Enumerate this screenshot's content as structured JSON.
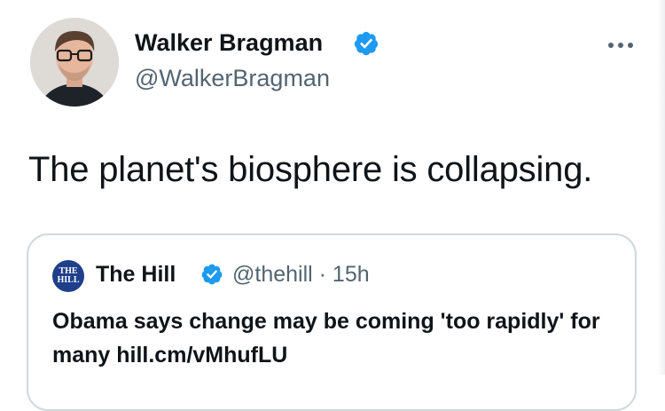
{
  "author": {
    "name": "Walker Bragman",
    "handle": "@WalkerBragman"
  },
  "tweet": {
    "text": "The planet's biosphere is collapsing."
  },
  "quoted": {
    "avatar_text_line1": "THE",
    "avatar_text_line2": "HILL",
    "name": "The Hill",
    "handle_time": "@thehill · 15h",
    "text": "Obama says change may be coming 'too rapidly' for many hill.cm/vMhufLU"
  },
  "icons": {
    "verified": "verified-badge-icon",
    "more": "more-horizontal-icon"
  },
  "colors": {
    "verified_blue": "#1d9bf0",
    "text_primary": "#0f1419",
    "text_secondary": "#536471",
    "card_border": "#cfd9de",
    "hill_logo": "#1f3f8a"
  }
}
